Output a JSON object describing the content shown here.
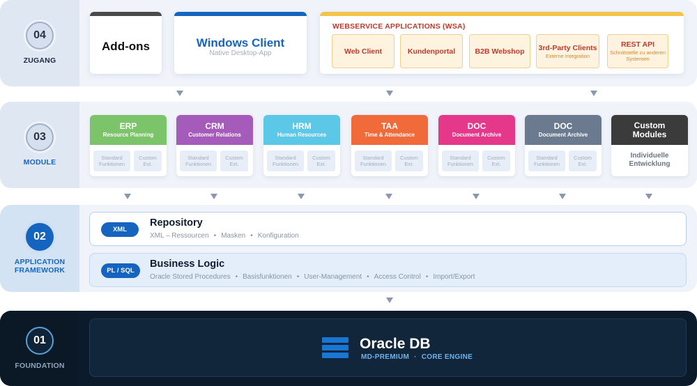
{
  "layers": {
    "zugang": {
      "number": "04",
      "label": "ZUGANG",
      "addons": {
        "title": "Add-ons"
      },
      "windows_client": {
        "title": "Windows Client",
        "subtitle": "Native Desktop-App"
      },
      "wsa": {
        "title": "WEBSERVICE APPLICATIONS (WSA)",
        "items": [
          {
            "label": "Web Client",
            "sub": ""
          },
          {
            "label": "Kundenportal",
            "sub": ""
          },
          {
            "label": "B2B Webshop",
            "sub": ""
          },
          {
            "label": "3rd-Party Clients",
            "sub": "Externe Integration"
          },
          {
            "label": "REST API",
            "sub": "Schnittstelle zu anderen Systemen"
          }
        ]
      }
    },
    "module": {
      "number": "03",
      "label": "MODULE",
      "items": [
        {
          "title": "ERP",
          "subtitle": "Resource Planning",
          "color": "#7cc46a",
          "box_a": "Standard Funktionen",
          "box_b": "Custom Ext."
        },
        {
          "title": "CRM",
          "subtitle": "Customer Relations",
          "color": "#a55bb9",
          "box_a": "Standard Funktionen",
          "box_b": "Custom Ext."
        },
        {
          "title": "HRM",
          "subtitle": "Human Resources",
          "color": "#5cc8e8",
          "box_a": "Standard Funktionen",
          "box_b": "Custom Ext."
        },
        {
          "title": "TAA",
          "subtitle": "Time & Attendance",
          "color": "#f06a3a",
          "box_a": "Standard Funktionen",
          "box_b": "Custom Ext."
        },
        {
          "title": "DOC",
          "subtitle": "Document Archive",
          "color": "#e6388a",
          "box_a": "Standard Funktionen",
          "box_b": "Custom Ext."
        },
        {
          "title": "DOC",
          "subtitle": "Document Archive",
          "color": "#6c7a90",
          "box_a": "Standard Funktionen",
          "box_b": "Custom Ext."
        },
        {
          "title": "Custom Modules",
          "subtitle": "",
          "color": "#3b3b3b",
          "dev": "Individuelle Entwicklung"
        }
      ]
    },
    "framework": {
      "number": "02",
      "label": "APPLICATION FRAMEWORK",
      "repository": {
        "pill": "XML",
        "title": "Repository",
        "items": [
          "XML – Ressourcen",
          "Masken",
          "Konfiguration"
        ]
      },
      "logic": {
        "pill": "PL / SQL",
        "title": "Business Logic",
        "items": [
          "Oracle Stored Procedures",
          "Basisfunktionen",
          "User-Management",
          "Access Control",
          "Import/Export"
        ]
      }
    },
    "foundation": {
      "number": "01",
      "label": "FOUNDATION",
      "db": {
        "title": "Oracle DB",
        "tags": [
          "MD-PREMIUM",
          "CORE ENGINE"
        ]
      }
    }
  },
  "separator": "•",
  "tag_separator": "·",
  "icons": {
    "db": "database-icon",
    "arrow": "arrow-down-icon"
  }
}
